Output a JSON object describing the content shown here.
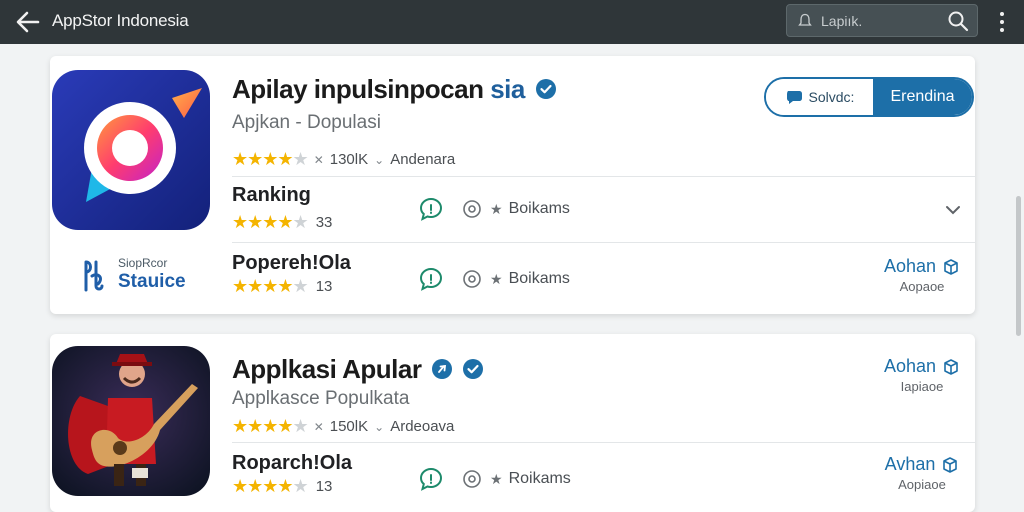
{
  "topbar": {
    "title": "AppStor Indonesia",
    "search_placeholder": "Lapiık."
  },
  "featured": {
    "name": "Apilay inpulsinpocan",
    "name_accent": "sia",
    "subtitle": "Apjkan - Dopulasi",
    "rating_stars": 3.5,
    "rating_count": "130lK",
    "rating_suffix": "Andenara",
    "btn_secondary": "Solvdc:",
    "btn_primary": "Erendina",
    "rows": [
      {
        "title": "Ranking",
        "stars": 4.5,
        "count": "33",
        "action_label": "Boikams"
      },
      {
        "title": "Popereh!Ola",
        "stars": 4.5,
        "count": "13",
        "action_label": "Boikams",
        "side_main": "Aohan",
        "side_sub": "Aopaoe"
      }
    ],
    "store_logo_small": "SiopRcor",
    "store_logo_big": "Stauice"
  },
  "second": {
    "name": "Applkasi Apular",
    "subtitle": "Applkasce Populkata",
    "rating_stars": 3.5,
    "rating_count": "150lK",
    "rating_suffix": "Ardeoava",
    "side1_main": "Aohan",
    "side1_sub": "Iapiaoe",
    "row": {
      "title": "Roparch!Ola",
      "stars": 4.5,
      "count": "13",
      "action_label": "Roikams",
      "side_main": "Avhan",
      "side_sub": "Aopiaoe"
    }
  },
  "colors": {
    "topbar": "#2f3639",
    "accent": "#1d6fa8",
    "star": "#f4b400"
  }
}
